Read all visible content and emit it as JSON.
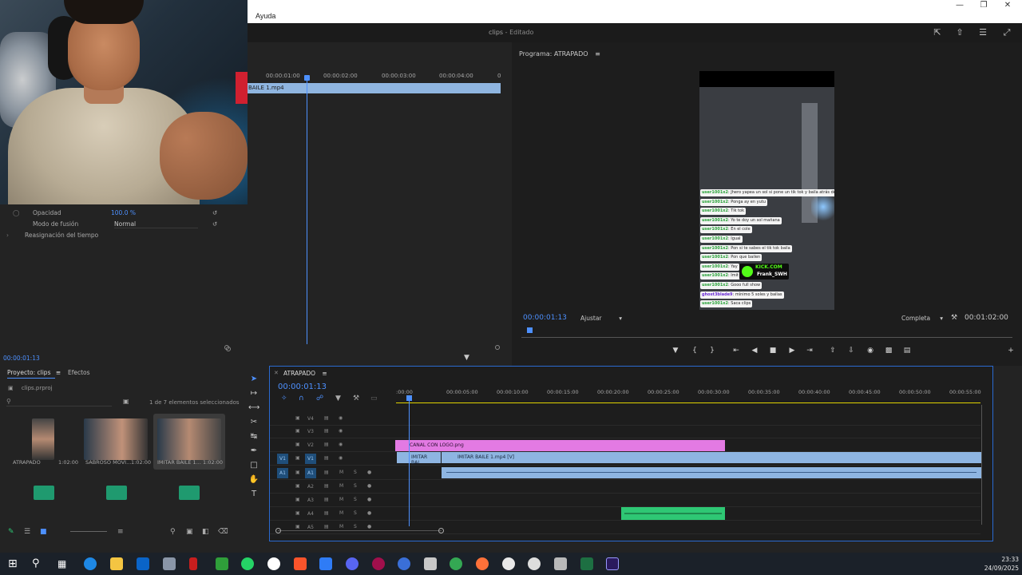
{
  "menubar": {
    "help_label": "Ayuda"
  },
  "titlebar": {
    "project": "clips",
    "separator": "-",
    "state": "Editado"
  },
  "effects": {
    "opacity_label": "Opacidad",
    "opacity_value": "100.0 %",
    "blend_label": "Modo de fusión",
    "blend_value": "Normal",
    "time_remap_label": "Reasignación del tiempo"
  },
  "source": {
    "ticks": [
      "00:00:01:00",
      "00:00:02:00",
      "00:00:03:00",
      "00:00:04:00",
      "0"
    ],
    "clip_name": "BAILE 1.mp4",
    "timecode": "00:00:01:13"
  },
  "program": {
    "title": "Programa: ATRAPADO",
    "timecode": "00:00:01:13",
    "fit_label": "Ajustar",
    "quality_label": "Completa",
    "duration": "00:01:02:00",
    "chat": [
      {
        "user": "user1001x2",
        "msg": ": Jhero yapea un sol si pone un tik tok y baila atrás de"
      },
      {
        "user": "user1001x2",
        "msg": ": Ponga ay en yutu"
      },
      {
        "user": "user1001x2",
        "msg": ": Tik tok"
      },
      {
        "user": "user1001x2",
        "msg": ": Yo te doy un sol mañana"
      },
      {
        "user": "user1001x2",
        "msg": ": En el cole"
      },
      {
        "user": "user1001x2",
        "msg": ": Igual"
      },
      {
        "user": "user1001x2",
        "msg": ": Pon si te sabes el tik tok baila"
      },
      {
        "user": "user1001x2",
        "msg": ": Pon que bailen"
      },
      {
        "user": "user1001x2",
        "msg": ": Yay"
      },
      {
        "user": "user1001x2",
        "msg": ": Imit"
      },
      {
        "user": "user1001x2",
        "msg": ": Gooo full show"
      },
      {
        "user": "ghost3blade9",
        "msg": ": mínimo 5 soles y bailas"
      },
      {
        "user": "user1001x2",
        "msg": ": Saca clips"
      }
    ],
    "kick_brand": "KICK.COM",
    "kick_user": "Frank_SWH"
  },
  "project": {
    "tab_project": "Proyecto: clips",
    "tab_effects": "Efectos",
    "file": "clips.prproj",
    "selection_count": "1 de 7 elementos seleccionados",
    "items": [
      {
        "name": "ATRAPADO",
        "duration": "1:02:00"
      },
      {
        "name": "SABROSO MOVI...",
        "duration": "1:02:00"
      },
      {
        "name": "IMITAR BAILE 1...",
        "duration": "1:02:00"
      }
    ]
  },
  "timeline": {
    "title": "ATRAPADO",
    "timecode": "00:00:01:13",
    "ticks": [
      ":00:00",
      "00:00:05:00",
      "00:00:10:00",
      "00:00:15:00",
      "00:00:20:00",
      "00:00:25:00",
      "00:00:30:00",
      "00:00:35:00",
      "00:00:40:00",
      "00:00:45:00",
      "00:00:50:00",
      "00:00:55:00"
    ],
    "tracks": [
      "V4",
      "V3",
      "V2",
      "V1",
      "A1",
      "A2",
      "A3",
      "A4",
      "A5"
    ],
    "source_v_label": "V1",
    "source_a_label": "A1",
    "clip_logo": "CANAL CON LOGO.png",
    "clip_video": "IMITAR BAILE 1.mp4 [V]",
    "clip_video_short": "IMITAR BAI"
  },
  "taskbar": {
    "time": "23:33",
    "date": "24/09/2025"
  }
}
